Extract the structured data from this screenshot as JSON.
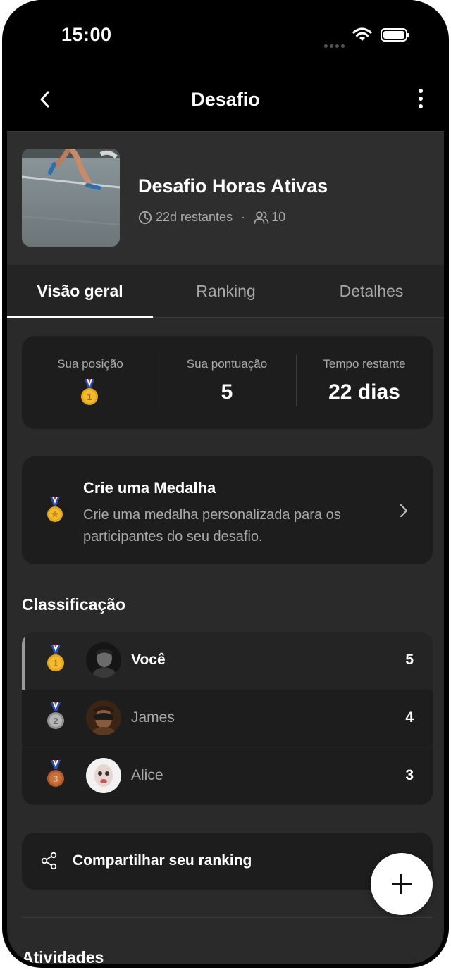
{
  "status_bar": {
    "time": "15:00"
  },
  "nav": {
    "title": "Desafio",
    "back_icon": "chevron-left-icon",
    "more_icon": "more-vertical-icon"
  },
  "challenge": {
    "title": "Desafio Horas Ativas",
    "remaining": "22d restantes",
    "separator": "·",
    "participants": "10"
  },
  "tabs": [
    {
      "label": "Visão geral",
      "active": true
    },
    {
      "label": "Ranking",
      "active": false
    },
    {
      "label": "Detalhes",
      "active": false
    }
  ],
  "stats": {
    "position_label": "Sua posição",
    "score_label": "Sua pontuação",
    "score_value": "5",
    "time_label": "Tempo restante",
    "time_value": "22 dias"
  },
  "medal_card": {
    "title": "Crie uma Medalha",
    "description": "Crie uma medalha personalizada para os participantes do seu desafio."
  },
  "leaderboard": {
    "title": "Classificação",
    "rows": [
      {
        "rank": 1,
        "name": "Você",
        "score": "5",
        "medal_color": "#e5a620"
      },
      {
        "rank": 2,
        "name": "James",
        "score": "4",
        "medal_color": "#a0a0a0"
      },
      {
        "rank": 3,
        "name": "Alice",
        "score": "3",
        "medal_color": "#b0582a"
      }
    ]
  },
  "share": {
    "label": "Compartilhar seu ranking"
  },
  "activities": {
    "title": "Atividades"
  },
  "colors": {
    "background": "#2a2a2a",
    "card": "#1d1d1d",
    "accent_white": "#ffffff",
    "muted_text": "#a9a9a9"
  }
}
